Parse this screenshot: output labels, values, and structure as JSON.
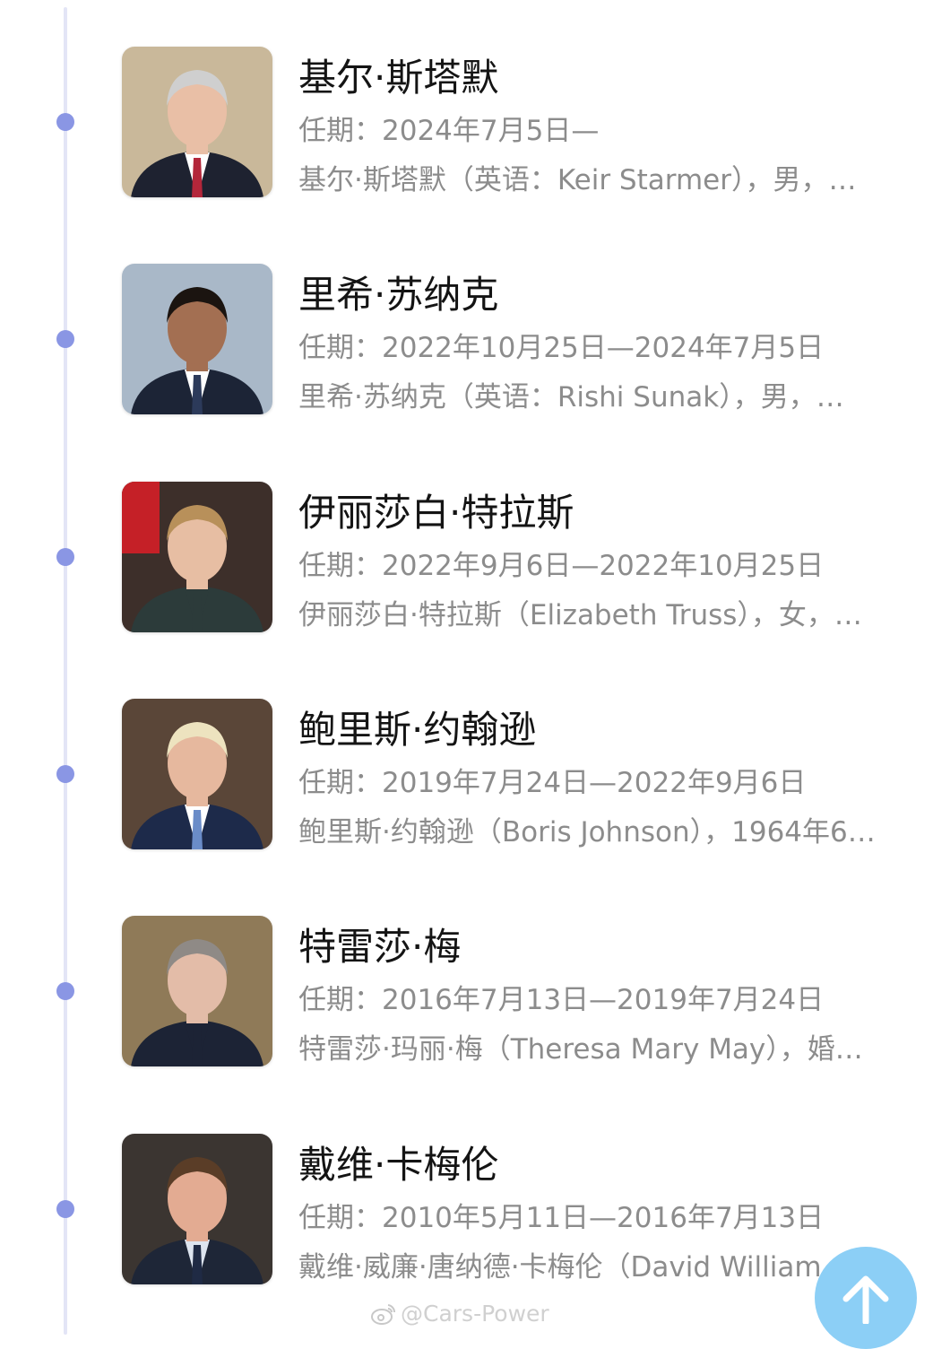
{
  "entries": [
    {
      "name": "基尔·斯塔默",
      "term": "任期：2024年7月5日—",
      "summary": "基尔·斯塔默（英语：Keir Starmer），男，…",
      "photo": {
        "bg": "#c9b89a",
        "hair": "#cfcfcf",
        "skin": "#e9bfa6",
        "suit": "#1e2230",
        "shirt": "#ffffff",
        "tie": "#b3263a"
      }
    },
    {
      "name": "里希·苏纳克",
      "term": "任期：2022年10月25日—2024年7月5日",
      "summary": "里希·苏纳克（英语：Rishi Sunak），男，…",
      "photo": {
        "bg": "#a9b8c8",
        "hair": "#1b1410",
        "skin": "#a36f52",
        "suit": "#1c2436",
        "shirt": "#ffffff",
        "tie": "#2c3a5a"
      }
    },
    {
      "name": "伊丽莎白·特拉斯",
      "term": "任期：2022年9月6日—2022年10月25日",
      "summary": "伊丽莎白·特拉斯（Elizabeth Truss），女，…",
      "photo": {
        "bg": "#3d2f2a",
        "hair": "#b8905a",
        "skin": "#e7bea3",
        "suit": "#2c3b3a",
        "shirt": "#2c3b3a",
        "tie": "#2c3b3a"
      }
    },
    {
      "name": "鲍里斯·约翰逊",
      "term": "任期：2019年7月24日—2022年9月6日",
      "summary": "鲍里斯·约翰逊（Boris Johnson），1964年6…",
      "photo": {
        "bg": "#5a4638",
        "hair": "#ede3bf",
        "skin": "#e6b89e",
        "suit": "#1d2a4a",
        "shirt": "#ffffff",
        "tie": "#6a8cc8"
      }
    },
    {
      "name": "特雷莎·梅",
      "term": "任期：2016年7月13日—2019年7月24日",
      "summary": "特雷莎·玛丽·梅（Theresa Mary May），婚…",
      "photo": {
        "bg": "#8f7a58",
        "hair": "#8f8a86",
        "skin": "#e3bca8",
        "suit": "#1c2335",
        "shirt": "#1c2335",
        "tie": "#1c2335"
      }
    },
    {
      "name": "戴维·卡梅伦",
      "term": "任期：2010年5月11日—2016年7月13日",
      "summary": "戴维·威廉·唐纳德·卡梅伦（David William",
      "photo": {
        "bg": "#3b3531",
        "hair": "#5a3d27",
        "skin": "#e3ab92",
        "suit": "#1e2637",
        "shirt": "#dde4ef",
        "tie": "#1f2a44"
      }
    }
  ],
  "watermark": "@Cars-Power",
  "scroll_top_icon": "arrow-up-icon",
  "colors": {
    "timeline": "#e3e5f6",
    "dot": "#8a96e4",
    "scroll_button": "#8ccff6",
    "title_text": "#141414",
    "secondary_text": "#8c8c8c"
  }
}
